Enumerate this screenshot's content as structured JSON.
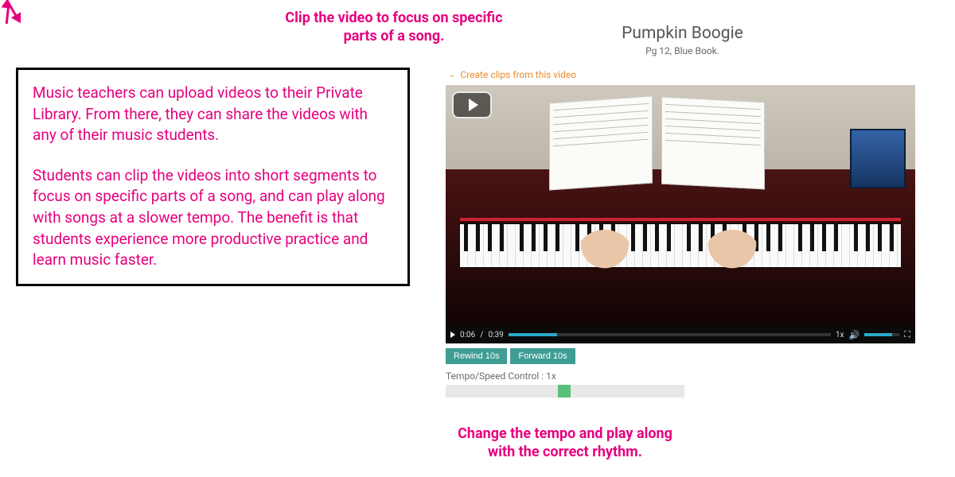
{
  "annotations": {
    "top": "Clip the video to focus on specific parts of a song.",
    "bottom": "Change the tempo and play along with the correct rhythm."
  },
  "info_box": {
    "p1": "Music teachers can upload videos to their Private Library. From there, they can share the videos with any of their music students.",
    "p2": "Students can clip the videos into short segments to focus on specific parts of a song, and can play along with songs at a slower tempo. The benefit is that students experience more productive practice and learn music faster."
  },
  "video": {
    "title": "Pumpkin Boogie",
    "subtitle": "Pg 12, Blue Book.",
    "create_clips_label": "Create clips from this video",
    "current_time": "0:06",
    "duration": "0:39",
    "time_separator": "/",
    "playback_speed": "1x"
  },
  "skip": {
    "rewind": "Rewind 10s",
    "forward": "Forward 10s"
  },
  "tempo": {
    "label": "Tempo/Speed Control : 1x"
  },
  "colors": {
    "accent_pink": "#e6007e",
    "accent_orange": "#e98a2e",
    "btn_teal": "#3f9d96",
    "slider_green": "#58c07b",
    "progress_blue": "#2aa9c9"
  }
}
